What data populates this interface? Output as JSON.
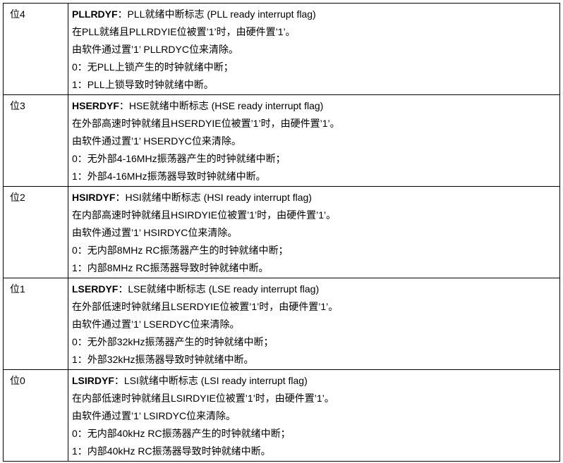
{
  "rows": [
    {
      "bit": "位4",
      "name": "PLLRDYF",
      "title": "：PLL就绪中断标志 (PLL ready interrupt flag)",
      "lines": [
        "在PLL就绪且PLLRDYIE位被置’1’时，由硬件置’1’。",
        "由软件通过置’1’ PLLRDYC位来清除。",
        "0：无PLL上锁产生的时钟就绪中断；",
        "1：PLL上锁导致时钟就绪中断。"
      ]
    },
    {
      "bit": "位3",
      "name": "HSERDYF",
      "title": "：HSE就绪中断标志 (HSE ready interrupt flag)",
      "lines": [
        "在外部高速时钟就绪且HSERDYIE位被置’1’时，由硬件置’1’。",
        "由软件通过置’1’ HSERDYC位来清除。",
        "0：无外部4-16MHz振荡器产生的时钟就绪中断；",
        "1：外部4-16MHz振荡器导致时钟就绪中断。"
      ]
    },
    {
      "bit": "位2",
      "name": "HSIRDYF",
      "title": "：HSI就绪中断标志 (HSI ready interrupt flag)",
      "lines": [
        "在内部高速时钟就绪且HSIRDYIE位被置’1’时，由硬件置’1’。",
        "由软件通过置’1’ HSIRDYC位来清除。",
        "0：无内部8MHz RC振荡器产生的时钟就绪中断；",
        "1：内部8MHz RC振荡器导致时钟就绪中断。"
      ]
    },
    {
      "bit": "位1",
      "name": "LSERDYF",
      "title": "：LSE就绪中断标志 (LSE ready interrupt flag)",
      "lines": [
        "在外部低速时钟就绪且LSERDYIE位被置’1’时，由硬件置’1’。",
        "由软件通过置’1’ LSERDYC位来清除。",
        "0：无外部32kHz振荡器产生的时钟就绪中断；",
        "1：外部32kHz振荡器导致时钟就绪中断。"
      ]
    },
    {
      "bit": "位0",
      "name": "LSIRDYF",
      "title": "：LSI就绪中断标志 (LSI ready interrupt flag)",
      "lines": [
        "在内部低速时钟就绪且LSIRDYIE位被置’1’时，由硬件置’1’。",
        "由软件通过置’1’ LSIRDYC位来清除。",
        "0：无内部40kHz RC振荡器产生的时钟就绪中断；",
        "1：内部40kHz RC振荡器导致时钟就绪中断。"
      ]
    }
  ]
}
